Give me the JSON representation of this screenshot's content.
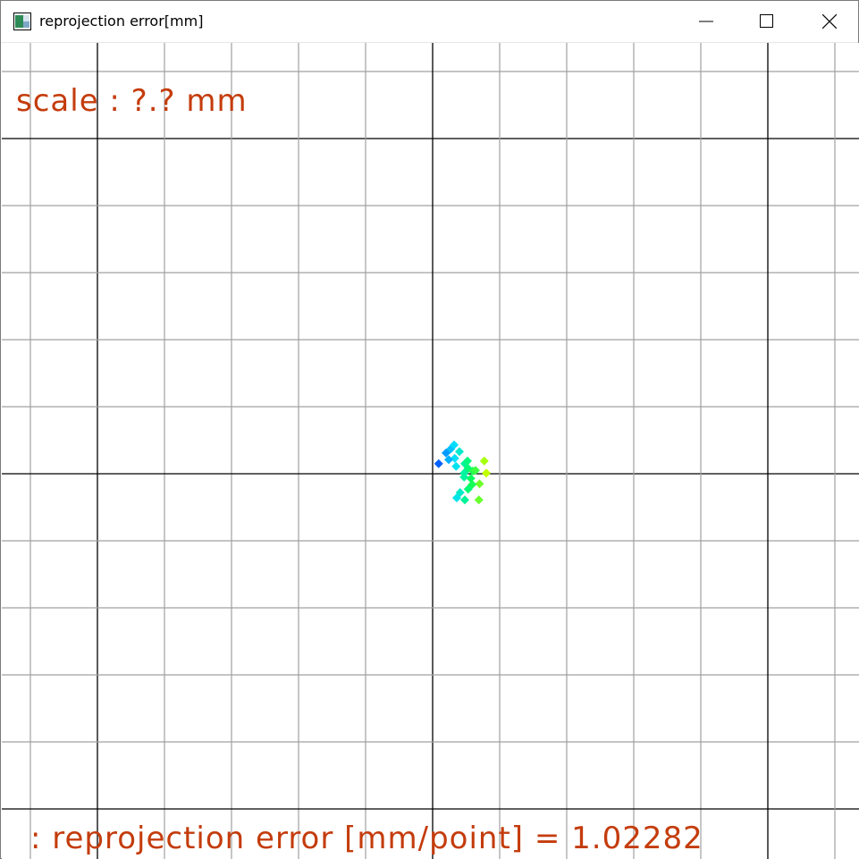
{
  "window": {
    "title": "reprojection error[mm]",
    "controls": [
      "minimize-icon",
      "maximize-icon",
      "close-icon"
    ]
  },
  "overlay": {
    "scale_text": "scale : ?.? mm",
    "error_text": ": reprojection error [mm/point] = 1.02282"
  },
  "colors": {
    "text": "#c43c0c",
    "minor_grid": "#a0a0a0",
    "major_grid": "#000000",
    "point_gradient": [
      "#0060ff",
      "#00e0ff",
      "#00ff60",
      "#c0ff00"
    ]
  },
  "chart_data": {
    "type": "scatter",
    "xlim": [
      -6.4,
      6.4
    ],
    "ylim": [
      -6.2,
      6.0
    ],
    "grid": true,
    "points": [
      {
        "x": 0.27,
        "y": 0.37
      },
      {
        "x": 0.32,
        "y": 0.43
      },
      {
        "x": 0.2,
        "y": 0.31
      },
      {
        "x": 0.09,
        "y": 0.15
      },
      {
        "x": 0.33,
        "y": 0.23
      },
      {
        "x": 0.4,
        "y": 0.33
      },
      {
        "x": 0.48,
        "y": 0.15
      },
      {
        "x": 0.53,
        "y": 0.08
      },
      {
        "x": 0.6,
        "y": 0.04
      },
      {
        "x": 0.47,
        "y": 0.01
      },
      {
        "x": 0.35,
        "y": 0.11
      },
      {
        "x": 0.57,
        "y": -0.07
      },
      {
        "x": 0.64,
        "y": 0.05
      },
      {
        "x": 0.7,
        "y": -0.15
      },
      {
        "x": 0.41,
        "y": -0.28
      },
      {
        "x": 0.48,
        "y": -0.39
      },
      {
        "x": 0.69,
        "y": -0.39
      },
      {
        "x": 0.8,
        "y": 0.01
      },
      {
        "x": 0.77,
        "y": 0.19
      },
      {
        "x": 0.52,
        "y": 0.19
      },
      {
        "x": 0.59,
        "y": -0.16
      },
      {
        "x": 0.36,
        "y": -0.36
      },
      {
        "x": 0.24,
        "y": 0.21
      },
      {
        "x": 0.53,
        "y": -0.23
      },
      {
        "x": 0.47,
        "y": -0.05
      }
    ]
  }
}
